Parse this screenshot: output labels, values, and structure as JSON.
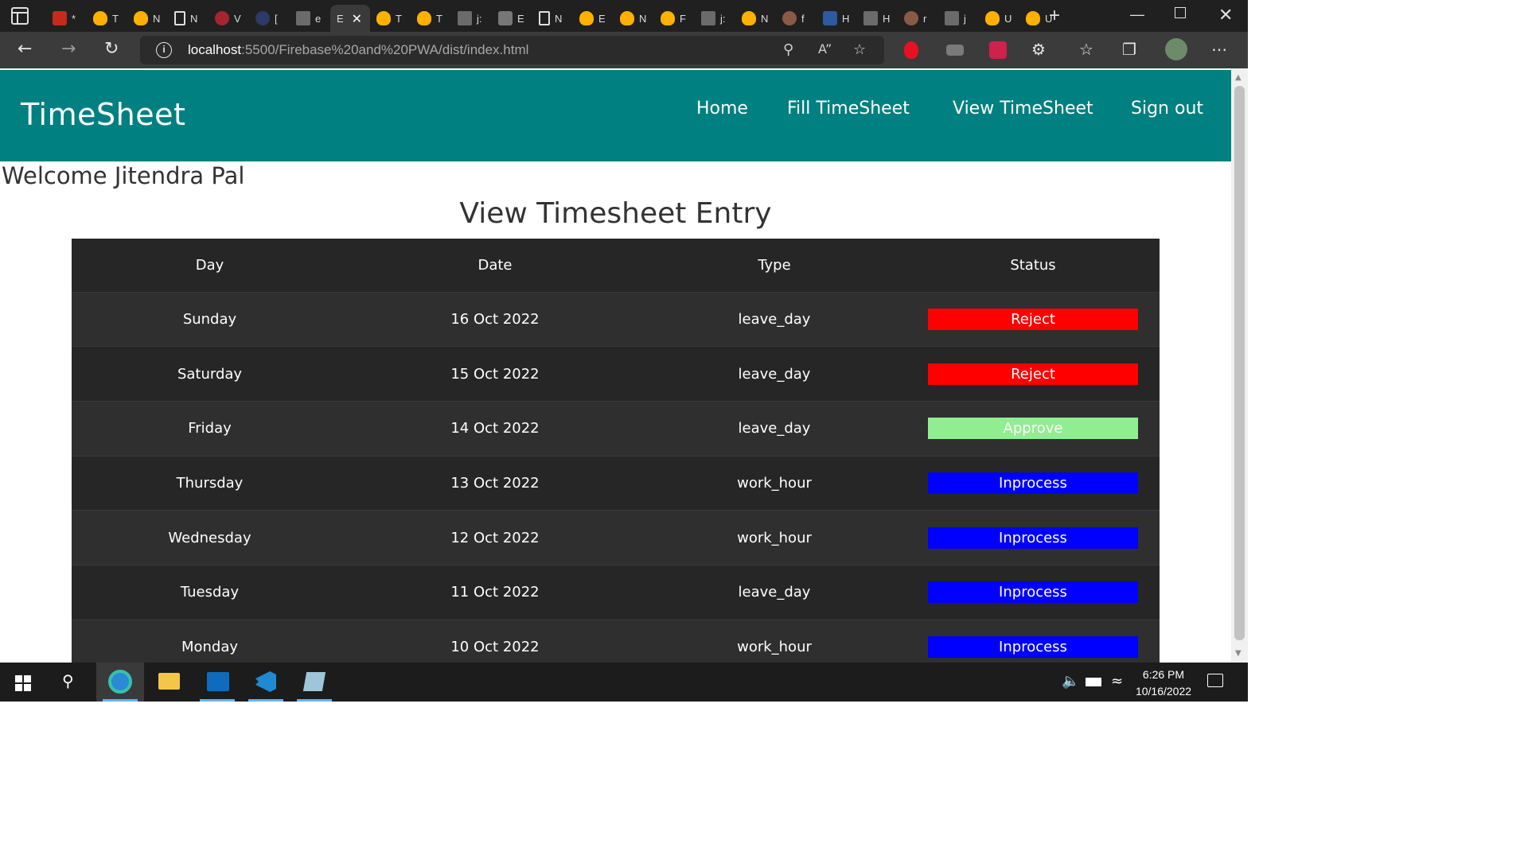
{
  "browser": {
    "tabs": [
      {
        "icon": "pdf-icon",
        "char": "*"
      },
      {
        "icon": "firebase-icon",
        "char": "T"
      },
      {
        "icon": "firebase-icon",
        "char": "N"
      },
      {
        "icon": "document-icon",
        "char": "N"
      },
      {
        "icon": "red-circle-icon",
        "char": "V"
      },
      {
        "icon": "blue-circle-icon",
        "char": "["
      },
      {
        "icon": "stackoverflow-icon",
        "char": "e"
      },
      {
        "icon": "active-tab",
        "char": "E",
        "active": true
      },
      {
        "icon": "firebase-icon",
        "char": "T"
      },
      {
        "icon": "firebase-icon",
        "char": "T"
      },
      {
        "icon": "stackoverflow-icon",
        "char": "j:"
      },
      {
        "icon": "ex-icon",
        "char": "E"
      },
      {
        "icon": "document-icon",
        "char": "N"
      },
      {
        "icon": "firebase-icon",
        "char": "E"
      },
      {
        "icon": "firebase-icon",
        "char": "N"
      },
      {
        "icon": "firebase-icon",
        "char": "F"
      },
      {
        "icon": "stackoverflow-icon",
        "char": "j:"
      },
      {
        "icon": "firebase-icon",
        "char": "N"
      },
      {
        "icon": "github-icon",
        "char": "f"
      },
      {
        "icon": "ub-icon",
        "char": "H"
      },
      {
        "icon": "stackoverflow-icon",
        "char": "H"
      },
      {
        "icon": "github-icon",
        "char": "r"
      },
      {
        "icon": "stackoverflow-icon",
        "char": "j"
      },
      {
        "icon": "firebase-icon",
        "char": "U"
      },
      {
        "icon": "firebase-icon",
        "char": "U"
      }
    ],
    "active_tab_label": "E",
    "url_host": "localhost",
    "url_path": ":5500/Firebase%20and%20PWA/dist/index.html"
  },
  "app": {
    "brand": "TimeSheet",
    "nav": [
      "Home",
      "Fill TimeSheet",
      "View TimeSheet",
      "Sign out"
    ],
    "welcome": "Welcome Jitendra Pal",
    "heading": "View Timesheet Entry"
  },
  "table": {
    "columns": [
      "Day",
      "Date",
      "Type",
      "Status"
    ],
    "rows": [
      {
        "day": "Sunday",
        "date": "16 Oct 2022",
        "type": "leave_day",
        "status": "Reject"
      },
      {
        "day": "Saturday",
        "date": "15 Oct 2022",
        "type": "leave_day",
        "status": "Reject"
      },
      {
        "day": "Friday",
        "date": "14 Oct 2022",
        "type": "leave_day",
        "status": "Approve"
      },
      {
        "day": "Thursday",
        "date": "13 Oct 2022",
        "type": "work_hour",
        "status": "Inprocess"
      },
      {
        "day": "Wednesday",
        "date": "12 Oct 2022",
        "type": "work_hour",
        "status": "Inprocess"
      },
      {
        "day": "Tuesday",
        "date": "11 Oct 2022",
        "type": "leave_day",
        "status": "Inprocess"
      },
      {
        "day": "Monday",
        "date": "10 Oct 2022",
        "type": "work_hour",
        "status": "Inprocess"
      }
    ]
  },
  "status_colors": {
    "Reject": "#ff0000",
    "Approve": "#90ee90",
    "Inprocess": "#0000ff"
  },
  "colors": {
    "navbar": "#008080",
    "table_dark": "#262626",
    "table_light": "#2f2f2f"
  },
  "taskbar": {
    "time": "6:26 PM",
    "date": "10/16/2022"
  }
}
